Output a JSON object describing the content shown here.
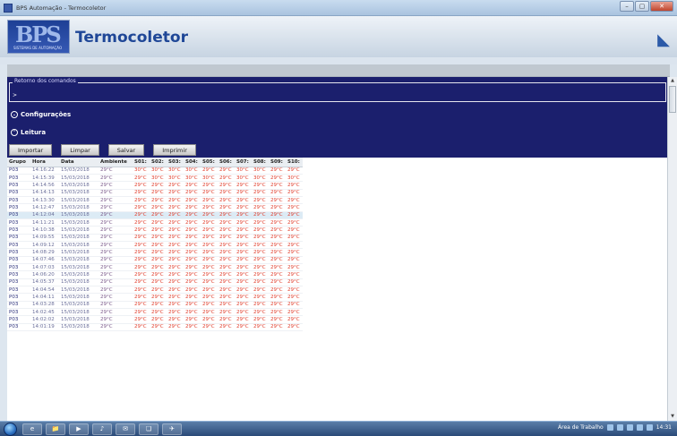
{
  "window": {
    "title": "BPS Automação - Termocoletor",
    "min_label": "–",
    "max_label": "▢",
    "close_label": "✕"
  },
  "header": {
    "app_title": "Termocoletor",
    "logo_big": "BPS",
    "logo_small": "SISTEMAS DE AUTOMAÇÃO",
    "corner_glyph": "◣"
  },
  "commands": {
    "legend": "Retorno dos comandos",
    "prompt": ">"
  },
  "sections": {
    "config": {
      "label": "Configurações",
      "glyph": "⌄"
    },
    "reading": {
      "label": "Leitura",
      "glyph": "⌃"
    }
  },
  "toolbar": {
    "import_label": "Importar",
    "clear_label": "Limpar",
    "save_label": "Salvar",
    "print_label": "Imprimir"
  },
  "table": {
    "columns": [
      "Grupo",
      "Hora",
      "Data",
      "Ambiente",
      "S01:",
      "S02:",
      "S03:",
      "S04:",
      "S05:",
      "S06:",
      "S07:",
      "S08:",
      "S09:",
      "S10:"
    ],
    "selected_row": 6,
    "rows": [
      [
        "P03",
        "14:16:22",
        "15/03/2018",
        "29°C",
        "30°C",
        "30°C",
        "30°C",
        "30°C",
        "29°C",
        "29°C",
        "30°C",
        "30°C",
        "29°C",
        "29°C"
      ],
      [
        "P03",
        "14:15:39",
        "15/03/2018",
        "29°C",
        "29°C",
        "30°C",
        "30°C",
        "30°C",
        "30°C",
        "29°C",
        "30°C",
        "30°C",
        "29°C",
        "30°C"
      ],
      [
        "P03",
        "14:14:56",
        "15/03/2018",
        "29°C",
        "29°C",
        "29°C",
        "29°C",
        "29°C",
        "29°C",
        "29°C",
        "29°C",
        "29°C",
        "29°C",
        "29°C"
      ],
      [
        "P03",
        "14:14:13",
        "15/03/2018",
        "29°C",
        "29°C",
        "29°C",
        "29°C",
        "29°C",
        "29°C",
        "29°C",
        "29°C",
        "29°C",
        "29°C",
        "29°C"
      ],
      [
        "P03",
        "14:13:30",
        "15/03/2018",
        "29°C",
        "29°C",
        "29°C",
        "29°C",
        "29°C",
        "29°C",
        "29°C",
        "29°C",
        "29°C",
        "29°C",
        "29°C"
      ],
      [
        "P03",
        "14:12:47",
        "15/03/2018",
        "29°C",
        "29°C",
        "29°C",
        "29°C",
        "29°C",
        "29°C",
        "29°C",
        "29°C",
        "29°C",
        "29°C",
        "29°C"
      ],
      [
        "P03",
        "14:12:04",
        "15/03/2018",
        "29°C",
        "29°C",
        "29°C",
        "29°C",
        "29°C",
        "29°C",
        "29°C",
        "29°C",
        "29°C",
        "29°C",
        "29°C"
      ],
      [
        "P03",
        "14:11:21",
        "15/03/2018",
        "29°C",
        "29°C",
        "29°C",
        "29°C",
        "29°C",
        "29°C",
        "29°C",
        "29°C",
        "29°C",
        "29°C",
        "29°C"
      ],
      [
        "P03",
        "14:10:38",
        "15/03/2018",
        "29°C",
        "29°C",
        "29°C",
        "29°C",
        "29°C",
        "29°C",
        "29°C",
        "29°C",
        "29°C",
        "29°C",
        "29°C"
      ],
      [
        "P03",
        "14:09:55",
        "15/03/2018",
        "29°C",
        "29°C",
        "29°C",
        "29°C",
        "29°C",
        "29°C",
        "29°C",
        "29°C",
        "29°C",
        "29°C",
        "29°C"
      ],
      [
        "P03",
        "14:09:12",
        "15/03/2018",
        "29°C",
        "29°C",
        "29°C",
        "29°C",
        "29°C",
        "29°C",
        "29°C",
        "29°C",
        "29°C",
        "29°C",
        "29°C"
      ],
      [
        "P03",
        "14:08:29",
        "15/03/2018",
        "29°C",
        "29°C",
        "29°C",
        "29°C",
        "29°C",
        "29°C",
        "29°C",
        "29°C",
        "29°C",
        "29°C",
        "29°C"
      ],
      [
        "P03",
        "14:07:46",
        "15/03/2018",
        "29°C",
        "29°C",
        "29°C",
        "29°C",
        "29°C",
        "29°C",
        "29°C",
        "29°C",
        "29°C",
        "29°C",
        "29°C"
      ],
      [
        "P03",
        "14:07:03",
        "15/03/2018",
        "29°C",
        "29°C",
        "29°C",
        "29°C",
        "29°C",
        "29°C",
        "29°C",
        "29°C",
        "29°C",
        "29°C",
        "29°C"
      ],
      [
        "P03",
        "14:06:20",
        "15/03/2018",
        "29°C",
        "29°C",
        "29°C",
        "29°C",
        "29°C",
        "29°C",
        "29°C",
        "29°C",
        "29°C",
        "29°C",
        "29°C"
      ],
      [
        "P03",
        "14:05:37",
        "15/03/2018",
        "29°C",
        "29°C",
        "29°C",
        "29°C",
        "29°C",
        "29°C",
        "29°C",
        "29°C",
        "29°C",
        "29°C",
        "29°C"
      ],
      [
        "P03",
        "14:04:54",
        "15/03/2018",
        "29°C",
        "29°C",
        "29°C",
        "29°C",
        "29°C",
        "29°C",
        "29°C",
        "29°C",
        "29°C",
        "29°C",
        "29°C"
      ],
      [
        "P03",
        "14:04:11",
        "15/03/2018",
        "29°C",
        "29°C",
        "29°C",
        "29°C",
        "29°C",
        "29°C",
        "29°C",
        "29°C",
        "29°C",
        "29°C",
        "29°C"
      ],
      [
        "P03",
        "14:03:28",
        "15/03/2018",
        "29°C",
        "29°C",
        "29°C",
        "29°C",
        "29°C",
        "29°C",
        "29°C",
        "29°C",
        "29°C",
        "29°C",
        "29°C"
      ],
      [
        "P03",
        "14:02:45",
        "15/03/2018",
        "29°C",
        "29°C",
        "29°C",
        "29°C",
        "29°C",
        "29°C",
        "29°C",
        "29°C",
        "29°C",
        "29°C",
        "29°C"
      ],
      [
        "P03",
        "14:02:02",
        "15/03/2018",
        "29°C",
        "29°C",
        "29°C",
        "29°C",
        "29°C",
        "29°C",
        "29°C",
        "29°C",
        "29°C",
        "29°C",
        "29°C"
      ],
      [
        "P03",
        "14:01:19",
        "15/03/2018",
        "29°C",
        "29°C",
        "29°C",
        "29°C",
        "29°C",
        "29°C",
        "29°C",
        "29°C",
        "29°C",
        "29°C",
        "29°C"
      ]
    ]
  },
  "taskbar": {
    "desktop_label": "Área de Trabalho",
    "clock": "14:31",
    "apps": [
      "e",
      "📁",
      "▶",
      "♪",
      "✉",
      "❏",
      "✈"
    ]
  },
  "colors": {
    "panel": "#1b1f6d",
    "sensor_text": "#e03c2a",
    "selection": "#dcebf5"
  }
}
